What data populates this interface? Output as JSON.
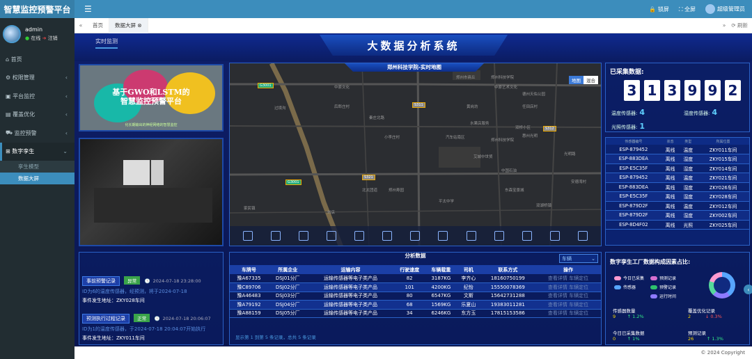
{
  "app": {
    "title": "智慧监控预警平台"
  },
  "topbar": {
    "lock": "锁屏",
    "fullscreen": "全屏",
    "user": "超级管理员"
  },
  "user": {
    "name": "admin",
    "status": "在线",
    "logout": "注销"
  },
  "sidebar": {
    "items": [
      {
        "label": "首页",
        "icon": "home-icon"
      },
      {
        "label": "权限管理",
        "icon": "gear-icon"
      },
      {
        "label": "平台监控",
        "icon": "monitor-icon"
      },
      {
        "label": "覆盖优化",
        "icon": "layers-icon"
      },
      {
        "label": "监控预警",
        "icon": "truck-icon"
      },
      {
        "label": "数字孪生",
        "icon": "sitemap-icon"
      }
    ],
    "sub": [
      {
        "label": "孪生模型"
      },
      {
        "label": "数据大屏"
      }
    ]
  },
  "tabs": {
    "home": "首页",
    "screen": "数据大屏",
    "refresh": "刷新"
  },
  "main": {
    "realtime_tab": "实时监测",
    "title": "大数据分析系统"
  },
  "ppt": {
    "title_line1": "基于GWO和LSTM的",
    "title_line2": "智慧监控预警平台",
    "subtitle": "化长期输出的神经网络的智慧监控"
  },
  "map": {
    "title": "郑州科技学院-实时地图",
    "switch_map": "地图",
    "switch_mix": "混合",
    "labels": [
      "过境沟",
      "郑州市商丘",
      "郑州科技学院",
      "中原艺术文化",
      "德州天佑公园",
      "后郎庄村",
      "秦庄北路",
      "黄岗坊",
      "任田店村",
      "小李庄村",
      "双桥小区",
      "汽车站南区",
      "郑州科技学院",
      "水果店服务",
      "惠州光明",
      "光明路",
      "艾城中世贸",
      "中国石油",
      "东森宝景城",
      "北太团道",
      "郑州寿园",
      "家民镇",
      "安德湾村",
      "平太中学",
      "双湖桥镇",
      "刘店",
      "中原文化"
    ],
    "roads": [
      "G3001",
      "S311",
      "G3001",
      "S321",
      "S312"
    ]
  },
  "collected": {
    "label": "已采集数据:",
    "digits": [
      "3",
      "1",
      "3",
      "9",
      "9",
      "2"
    ]
  },
  "sensors": [
    {
      "label": "温度传感器:",
      "value": "4"
    },
    {
      "label": "湿度传感器:",
      "value": "4"
    },
    {
      "label": "光照传感器:",
      "value": "1"
    }
  ],
  "sensor_table": {
    "headers": [
      "传感器编号",
      "状态",
      "类型",
      "所属位置"
    ],
    "rows": [
      [
        "ESP-879452",
        "离线",
        "温度",
        "ZKY011车间"
      ],
      [
        "ESP-883DEA",
        "离线",
        "湿度",
        "ZKY015车间"
      ],
      [
        "ESP-E5C35F",
        "离线",
        "湿度",
        "ZKY014车间"
      ],
      [
        "ESP-879452",
        "离线",
        "温度",
        "ZKY021车间"
      ],
      [
        "ESP-883DEA",
        "离线",
        "湿度",
        "ZKY026车间"
      ],
      [
        "ESP-E5C35F",
        "离线",
        "湿度",
        "ZKY028车间"
      ],
      [
        "ESP-879D2F",
        "离线",
        "温度",
        "ZKY012车间"
      ],
      [
        "ESP-879D2F",
        "离线",
        "湿度",
        "ZKY002车间"
      ],
      [
        "ESP-8D4F02",
        "离线",
        "光照",
        "ZKY025车间"
      ]
    ]
  },
  "alerts": [
    {
      "btn": "事前预警记录",
      "badge": "异常",
      "badge_color": "#3aa34a",
      "time": "2024-07-18 23:28:00",
      "desc": "ID为6的温度传感器，经预测，将于2024-07-18",
      "place": "事件发生地址：ZKY028车间"
    },
    {
      "btn": "预测执行过程记录",
      "badge": "正常",
      "badge_color": "#3aa34a",
      "time": "2024-07-18 20:06:07",
      "desc": "ID为1的温度传感器，于2024-07-18 20:04:07开始执行",
      "place": "事件发生地址：ZKY011车间"
    }
  ],
  "analysis": {
    "title": "分析数据",
    "select": "车辆",
    "headers": [
      "车牌号",
      "所属企业",
      "运输内容",
      "行驶速度",
      "车辆载重",
      "司机",
      "联系方式",
      "操作"
    ],
    "rows": [
      [
        "豫A67335",
        "DSJ01分厂",
        "运输传感器等电子类产品",
        "82",
        "3187KG",
        "李齐心",
        "18160750199",
        "查看详情 车辆定位"
      ],
      [
        "豫C89706",
        "DSJ02分厂",
        "运输传感器等电子类产品",
        "101",
        "4200KG",
        "纪怡",
        "15550078369",
        "查看详情 车辆定位"
      ],
      [
        "豫A46483",
        "DSJ03分厂",
        "运输传感器等电子类产品",
        "80",
        "6547KG",
        "文斯",
        "15642731288",
        "查看详情 车辆定位"
      ],
      [
        "豫A79192",
        "DSJ04分厂",
        "运输传感器等电子类产品",
        "68",
        "1569KG",
        "乐夏山",
        "19383011281",
        "查看详情 车辆定位"
      ],
      [
        "豫A88159",
        "DSJ05分厂",
        "运输传感器等电子类产品",
        "34",
        "6246KG",
        "东方玉",
        "17815153586",
        "查看详情 车辆定位"
      ]
    ],
    "footer": "显示第 1 到第 5 条记录，总共 5 条记录"
  },
  "factors": {
    "title": "数字孪生工厂数据构成因素占比:",
    "legend": [
      {
        "label": "今日已采集",
        "color": "#ff9ad0"
      },
      {
        "label": "预测记录",
        "color": "#d66fd0"
      },
      {
        "label": "传感器",
        "color": "#57a6ff"
      },
      {
        "label": "预警记录",
        "color": "#2ec16d"
      },
      {
        "label": "运行时间",
        "color": "#8e7bff"
      }
    ],
    "stats": [
      {
        "label": "传感器数量",
        "value": "9",
        "trend": "↑ 1.2%",
        "dir": "up"
      },
      {
        "label": "覆盖优化记录",
        "value": "2",
        "trend": "↓ 0.3%",
        "dir": "dn"
      },
      {
        "label": "今日已采集数据",
        "value": "0",
        "trend": "↑ 1%",
        "dir": "up"
      },
      {
        "label": "预测记录",
        "value": "26",
        "trend": "↑ 1.3%",
        "dir": "up"
      }
    ]
  },
  "footer": {
    "copyright": "© 2024 Copyright"
  }
}
